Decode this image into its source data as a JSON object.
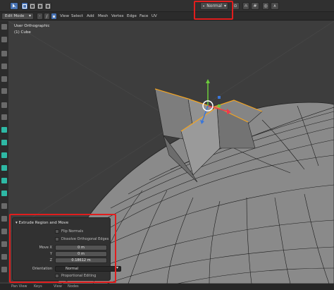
{
  "header": {
    "transform_orientation": "Normal"
  },
  "headerbar": {
    "mode": "Edit Mode",
    "menus": [
      "View",
      "Select",
      "Add",
      "Mesh",
      "Vertex",
      "Edge",
      "Face",
      "UV"
    ]
  },
  "viewport": {
    "view_name": "User Orthographic",
    "object_name": "(1) Cube"
  },
  "operator_panel": {
    "title": "Extrude Region and Move",
    "flip_normals_label": "Flip Normals",
    "dissolve_label": "Dissolve Orthogonal Edges",
    "move_x_label": "Move X",
    "y_label": "Y",
    "z_label": "Z",
    "move_x_value": "0 m",
    "y_value": "0 m",
    "z_value": "0.18612 m",
    "orientation_label": "Orientation",
    "orientation_value": "Normal",
    "proportional_label": "Proportional Editing"
  },
  "statusbar": {
    "items": [
      "Pan View",
      "Keys",
      "View",
      "Nodes"
    ]
  },
  "colors": {
    "accent": "#4772b3",
    "highlight": "#e11d1d",
    "selected_edge": "#f5a623"
  }
}
